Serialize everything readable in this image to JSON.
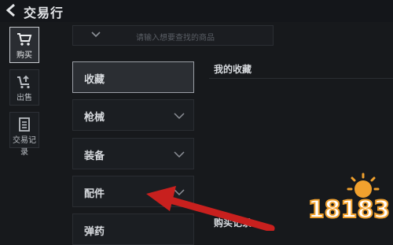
{
  "header": {
    "title": "交易行"
  },
  "search": {
    "placeholder": "请输入想要查找的商品"
  },
  "sidebar": {
    "items": [
      {
        "label": "购买",
        "icon": "cart-icon"
      },
      {
        "label": "出售",
        "icon": "sell-icon"
      },
      {
        "label": "交易记录",
        "icon": "record-icon"
      }
    ]
  },
  "categories": [
    {
      "label": "收藏"
    },
    {
      "label": "枪械"
    },
    {
      "label": "装备"
    },
    {
      "label": "配件"
    },
    {
      "label": "弹药"
    }
  ],
  "main": {
    "favorites_title": "我的收藏",
    "records_title": "购买记录"
  },
  "watermark": {
    "text": "18183"
  },
  "colors": {
    "background": "#17191c",
    "active_border": "#c9ccd1",
    "arrow": "#c8201e"
  }
}
